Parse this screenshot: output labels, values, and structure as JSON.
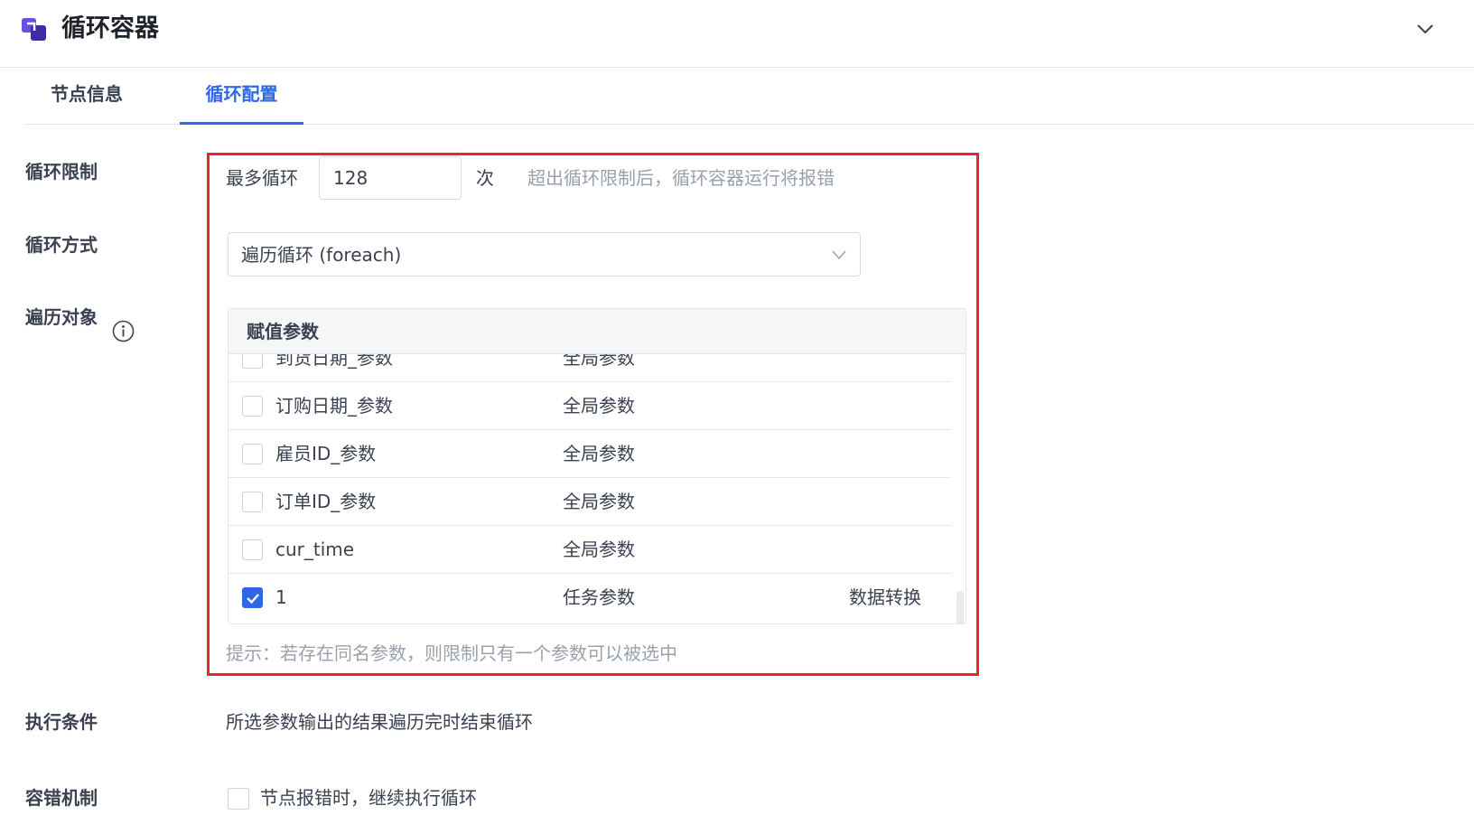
{
  "header": {
    "title": "循环容器",
    "logo_icon": "loop-container-logo",
    "collapse_icon": "chevron-down-icon"
  },
  "tabs": [
    {
      "label": "节点信息",
      "active": false
    },
    {
      "label": "循环配置",
      "active": true
    }
  ],
  "loop_limit": {
    "label": "循环限制",
    "prefix": "最多循环",
    "value": "128",
    "suffix": "次",
    "hint": "超出循环限制后，循环容器运行将报错"
  },
  "loop_mode": {
    "label": "循环方式",
    "selected": "遍历循环 (foreach)"
  },
  "iterate_target": {
    "label": "遍历对象",
    "info_icon": "info-icon",
    "table_header": "赋值参数",
    "rows": [
      {
        "name": "到货日期_参数",
        "scope": "全局参数",
        "source": "",
        "checked": false
      },
      {
        "name": "订购日期_参数",
        "scope": "全局参数",
        "source": "",
        "checked": false
      },
      {
        "name": "雇员ID_参数",
        "scope": "全局参数",
        "source": "",
        "checked": false
      },
      {
        "name": "订单ID_参数",
        "scope": "全局参数",
        "source": "",
        "checked": false
      },
      {
        "name": "cur_time",
        "scope": "全局参数",
        "source": "",
        "checked": false
      },
      {
        "name": "1",
        "scope": "任务参数",
        "source": "数据转换",
        "checked": true
      }
    ],
    "tip": "提示：若存在同名参数，则限制只有一个参数可以被选中"
  },
  "exec_condition": {
    "label": "执行条件",
    "value": "所选参数输出的结果遍历完时结束循环"
  },
  "fault_tolerance": {
    "label": "容错机制",
    "option": "节点报错时，继续执行循环",
    "checked": false
  },
  "colors": {
    "accent": "#2f66e8",
    "highlight_border": "#e8262f"
  }
}
